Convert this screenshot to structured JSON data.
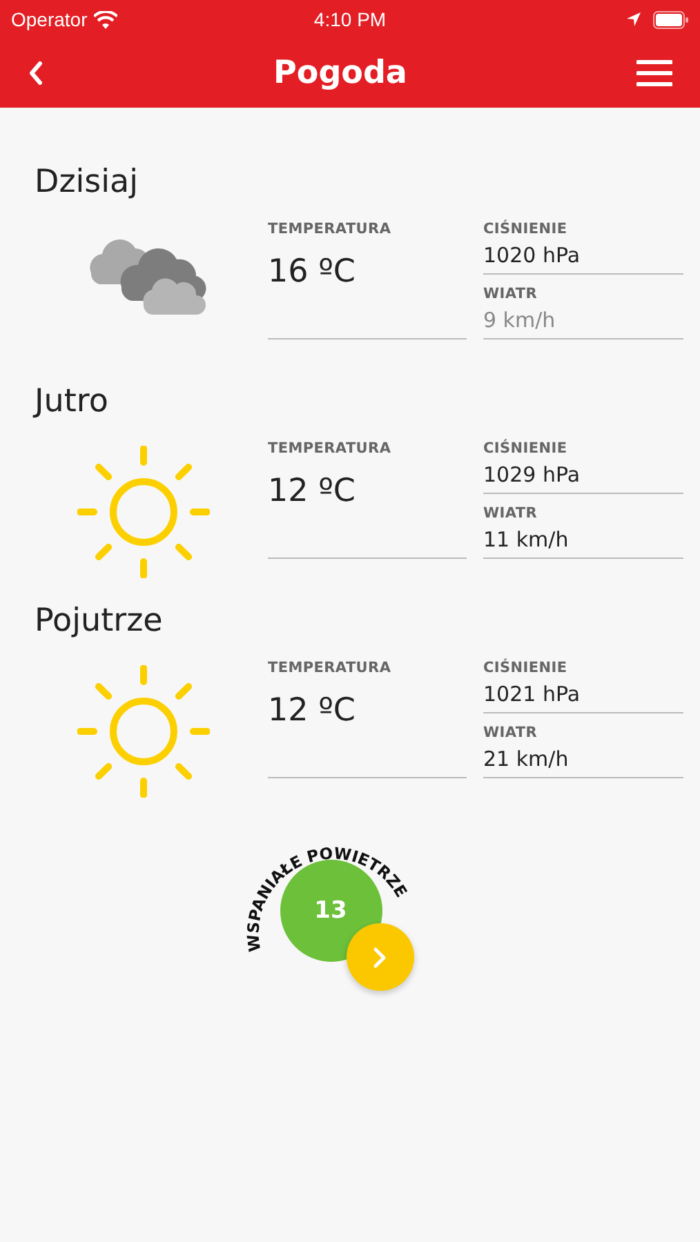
{
  "status_bar": {
    "carrier": "Operator",
    "time": "4:10 PM"
  },
  "header": {
    "title": "Pogoda"
  },
  "days": [
    {
      "title": "Dzisiaj",
      "kind": "cloudy",
      "temperature_label": "TEMPERATURA",
      "temperature": "16 ºC",
      "pressure_label": "CIŚNIENIE",
      "pressure": "1020 hPa",
      "wind_label": "WIATR",
      "wind": "9 km/h",
      "wind_dimmed": true
    },
    {
      "title": "Jutro",
      "kind": "sunny",
      "temperature_label": "TEMPERATURA",
      "temperature": "12 ºC",
      "pressure_label": "CIŚNIENIE",
      "pressure": "1029 hPa",
      "wind_label": "WIATR",
      "wind": "11 km/h",
      "wind_dimmed": false
    },
    {
      "title": "Pojutrze",
      "kind": "sunny",
      "temperature_label": "TEMPERATURA",
      "temperature": "12 ºC",
      "pressure_label": "CIŚNIENIE",
      "pressure": "1021 hPa",
      "wind_label": "WIATR",
      "wind": "21 km/h",
      "wind_dimmed": false
    }
  ],
  "air_quality": {
    "label": "WSPANIAŁE POWIETRZE",
    "value": "13",
    "color": "#6cc03a"
  }
}
